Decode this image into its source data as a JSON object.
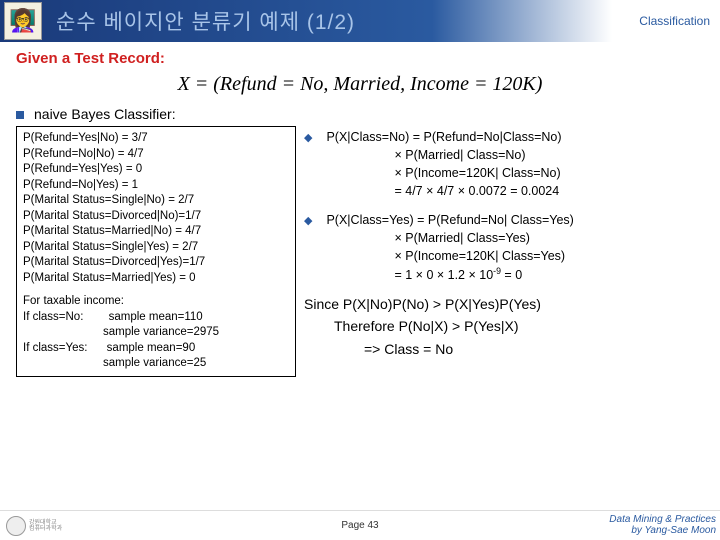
{
  "header": {
    "title": "순수 베이지안 분류기 예제 (1/2)",
    "category": "Classification"
  },
  "given": {
    "label": "Given a Test Record:",
    "formula": "X = (Refund = No, Married, Income = 120K)"
  },
  "classifier_label": "naive Bayes Classifier:",
  "left_probs": {
    "refund": [
      "P(Refund=Yes|No) = 3/7",
      "P(Refund=No|No) = 4/7",
      "P(Refund=Yes|Yes) = 0",
      "P(Refund=No|Yes) = 1"
    ],
    "marital": [
      "P(Marital Status=Single|No) = 2/7",
      "P(Marital Status=Divorced|No)=1/7",
      "P(Marital Status=Married|No) = 4/7",
      "P(Marital Status=Single|Yes) = 2/7",
      "P(Marital Status=Divorced|Yes)=1/7",
      "P(Marital Status=Married|Yes) = 0"
    ],
    "income_label": "For taxable income:",
    "income_no_prefix": "If class=No:",
    "income_no_mean": "sample mean=110",
    "income_no_var": "sample variance=2975",
    "income_yes_prefix": "If class=Yes:",
    "income_yes_mean": "sample mean=90",
    "income_yes_var": "sample variance=25"
  },
  "right": {
    "classNo": {
      "line1": "P(X|Class=No) = P(Refund=No|Class=No)",
      "line2": "× P(Married| Class=No)",
      "line3": "× P(Income=120K| Class=No)",
      "line4": "= 4/7 × 4/7 × 0.0072 = 0.0024"
    },
    "classYes": {
      "line1": "P(X|Class=Yes) = P(Refund=No| Class=Yes)",
      "line2": "× P(Married| Class=Yes)",
      "line3": "× P(Income=120K| Class=Yes)",
      "line4_prefix": "= 1 × 0 × 1.2 × 10",
      "line4_exp": "-9",
      "line4_suffix": " = 0"
    },
    "since1": "Since P(X|No)P(No) > P(X|Yes)P(Yes)",
    "since2": "Therefore P(No|X) > P(Yes|X)",
    "result": "=> Class = No"
  },
  "footer": {
    "page": "Page 43",
    "credit1": "Data Mining & Practices",
    "credit2": "by Yang-Sae Moon"
  }
}
